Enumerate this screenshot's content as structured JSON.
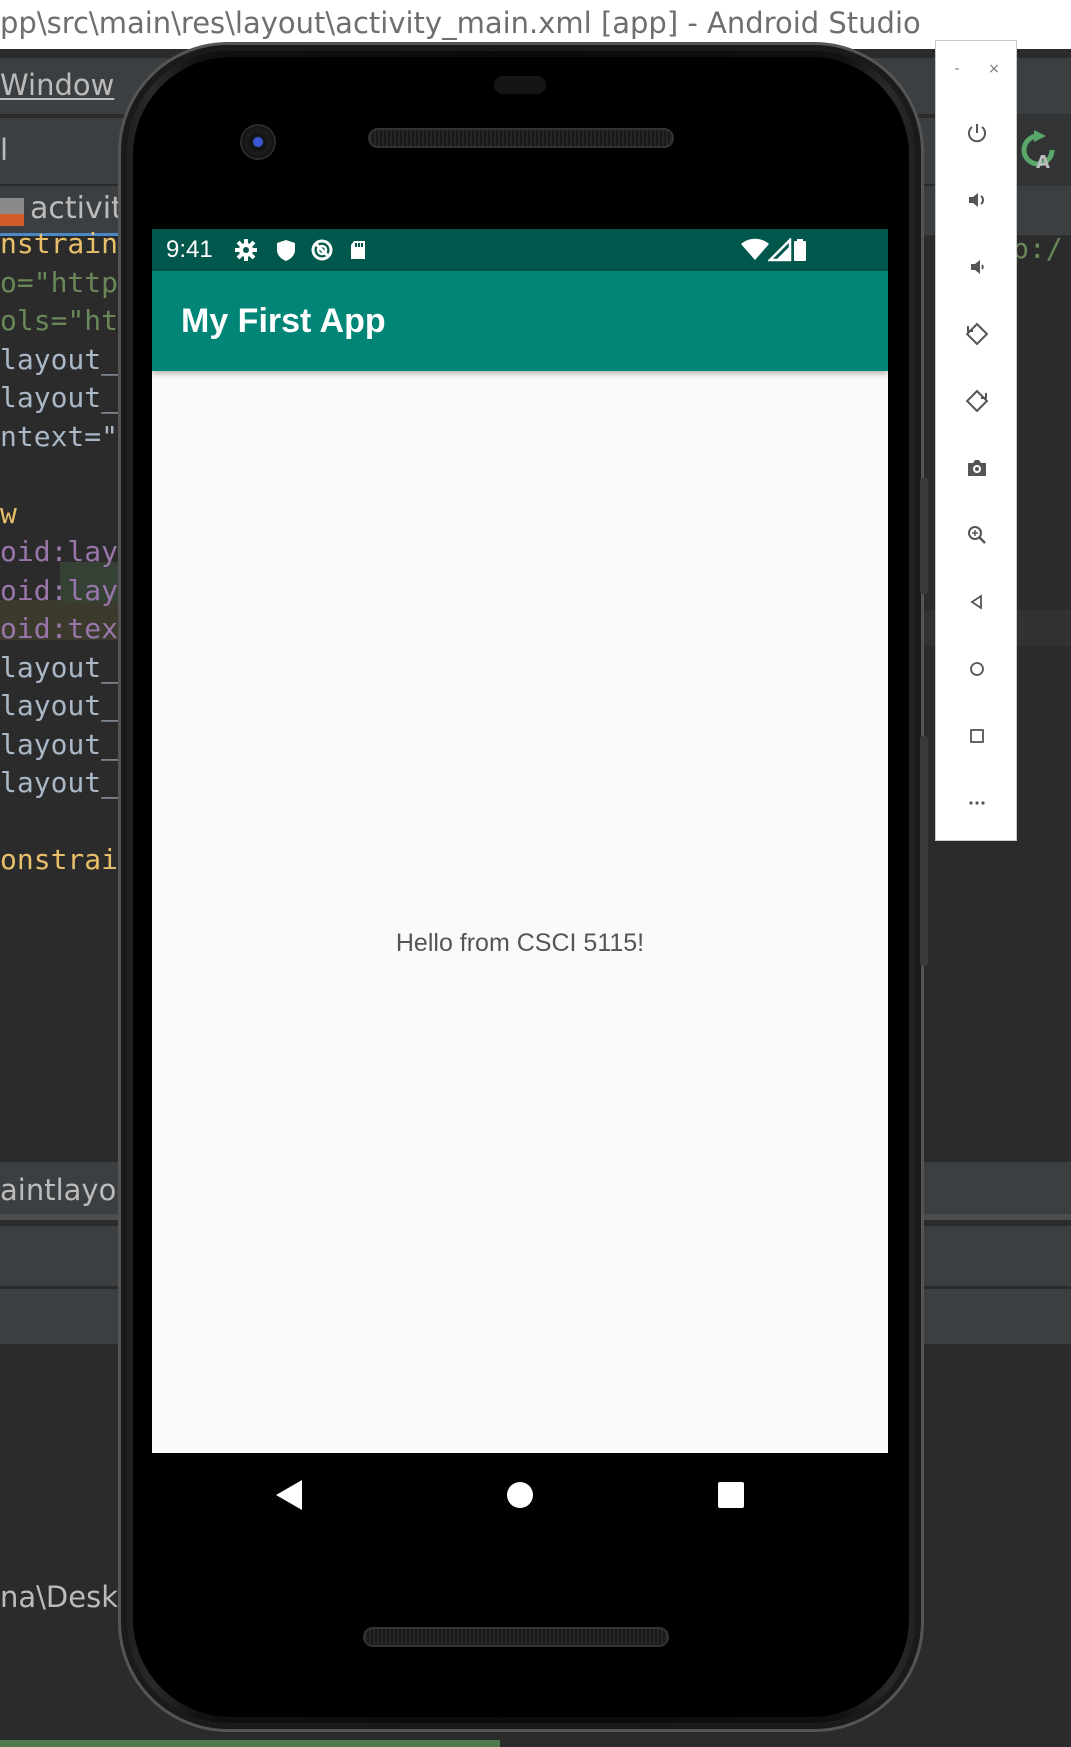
{
  "ide": {
    "window_title": "pp\\src\\main\\res\\layout\\activity_main.xml [app] - Android Studio",
    "menu_window": "Window",
    "toolbar_fragment": "l",
    "editor_tab_label": "activity",
    "panel_header": "aintlayout",
    "project_path": "na\\Deskt",
    "right_code_fragment": "p:/"
  },
  "code_lines": [
    {
      "text": "nstrain",
      "cls": "c-tag"
    },
    {
      "text": "o=\"http",
      "cls": "c-str"
    },
    {
      "text": "ols=\"ht",
      "cls": "c-str"
    },
    {
      "text": "layout_",
      "cls": "c-plain"
    },
    {
      "text": "layout_",
      "cls": "c-plain"
    },
    {
      "text": "ntext=\"",
      "cls": "c-plain"
    },
    {
      "text": "",
      "cls": "c-plain"
    },
    {
      "text": "w",
      "cls": "c-tag"
    },
    {
      "text": "oid:lay",
      "cls": "c-attr"
    },
    {
      "text": "oid:lay",
      "cls": "c-attr"
    },
    {
      "text": "oid:tex",
      "cls": "c-attr"
    },
    {
      "text": "layout_",
      "cls": "c-plain"
    },
    {
      "text": "layout_",
      "cls": "c-plain"
    },
    {
      "text": "layout_",
      "cls": "c-plain"
    },
    {
      "text": "layout_",
      "cls": "c-plain"
    },
    {
      "text": "",
      "cls": "c-plain"
    },
    {
      "text": "onstrai",
      "cls": "c-tag"
    }
  ],
  "device": {
    "status_time": "9:41",
    "app_title": "My First App",
    "hello_text": "Hello from CSCI 5115!"
  },
  "emulator_toolbar": {
    "minimize": "-",
    "close": "×",
    "buttons": [
      {
        "name": "power-icon"
      },
      {
        "name": "volume-up-icon"
      },
      {
        "name": "volume-down-icon"
      },
      {
        "name": "rotate-left-icon"
      },
      {
        "name": "rotate-right-icon"
      },
      {
        "name": "camera-icon"
      },
      {
        "name": "zoom-icon"
      },
      {
        "name": "back-icon"
      },
      {
        "name": "home-icon"
      },
      {
        "name": "overview-icon"
      },
      {
        "name": "more-icon"
      }
    ]
  },
  "colors": {
    "status_bar": "#00574b",
    "app_bar": "#008577",
    "screen_bg": "#fafafa"
  }
}
